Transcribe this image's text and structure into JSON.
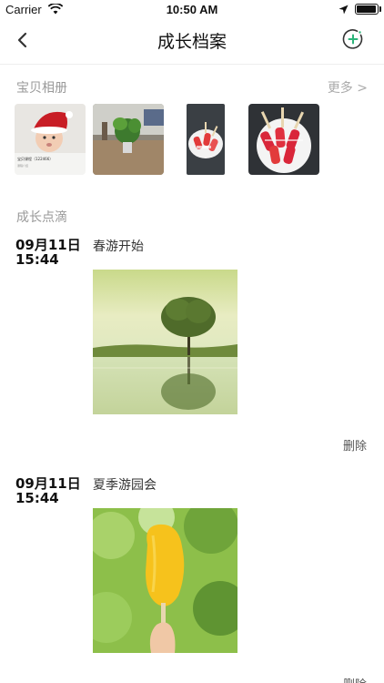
{
  "status_bar": {
    "carrier": "Carrier",
    "time": "10:50 AM",
    "icons": [
      "wifi-icon",
      "location-arrow-icon",
      "battery-icon"
    ]
  },
  "nav": {
    "title": "成长档案",
    "back_icon": "chevron-left-icon",
    "add_icon": "plus-circle-icon",
    "accent_color": "#2bb57a"
  },
  "album": {
    "label": "宝贝相册",
    "more": "更多 >",
    "photos": [
      {
        "subject": "baby-in-santa-hat",
        "caption": "宝贝课程（122466）",
        "sub": "课程介绍"
      },
      {
        "subject": "office-plant"
      },
      {
        "subject": "watermelon-popsicles-narrow"
      },
      {
        "subject": "watermelon-popsicles-bowl"
      }
    ]
  },
  "timeline": {
    "label": "成长点滴",
    "entries": [
      {
        "date": "09月11日",
        "time": "15:44",
        "title": "春游开始",
        "photo": "tree-reflection-lake",
        "delete": "删除"
      },
      {
        "date": "09月11日",
        "time": "15:44",
        "title": "夏季游园会",
        "photo": "mango-popsicle",
        "delete": "删除"
      }
    ]
  }
}
